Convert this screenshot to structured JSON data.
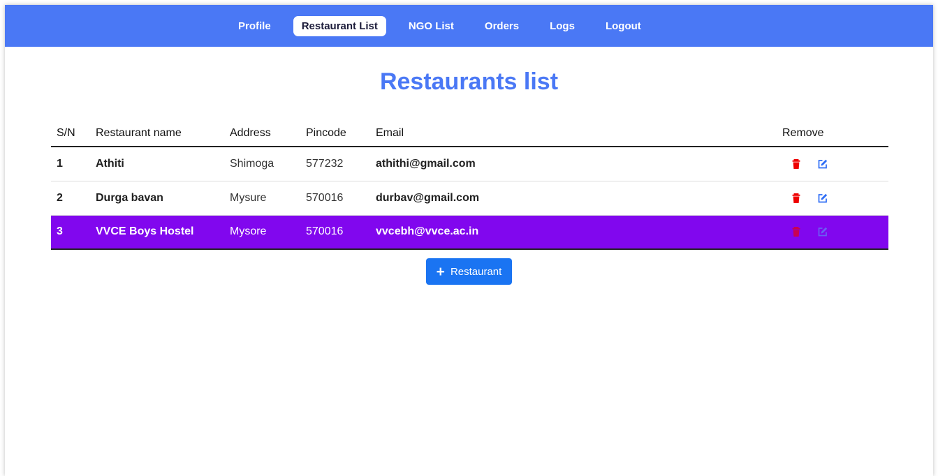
{
  "nav": {
    "items": [
      {
        "label": "Profile",
        "active": false
      },
      {
        "label": "Restaurant List",
        "active": true
      },
      {
        "label": "NGO List",
        "active": false
      },
      {
        "label": "Orders",
        "active": false
      },
      {
        "label": "Logs",
        "active": false
      },
      {
        "label": "Logout",
        "active": false
      }
    ]
  },
  "page": {
    "title": "Restaurants list"
  },
  "table": {
    "headers": [
      "S/N",
      "Restaurant name",
      "Address",
      "Pincode",
      "Email",
      "Remove"
    ],
    "rows": [
      {
        "sn": "1",
        "name": "Athiti",
        "address": "Shimoga",
        "pincode": "577232",
        "email": "athithi@gmail.com",
        "selected": false
      },
      {
        "sn": "2",
        "name": "Durga bavan",
        "address": "Mysure",
        "pincode": "570016",
        "email": "durbav@gmail.com",
        "selected": false
      },
      {
        "sn": "3",
        "name": "VVCE Boys Hostel",
        "address": "Mysore",
        "pincode": "570016",
        "email": "vvcebh@vvce.ac.in",
        "selected": true
      }
    ],
    "row_icons": {
      "delete": "trash-icon",
      "edit": "edit-icon"
    }
  },
  "add_button": {
    "icon": "plus-icon",
    "label": "Restaurant"
  },
  "colors": {
    "navbar": "#4a78f5",
    "title": "#4a78f5",
    "selected_row": "#8107ee",
    "delete_icon": "#ee0000",
    "edit_icon": "#2f6df5",
    "add_button": "#1a74f2"
  }
}
